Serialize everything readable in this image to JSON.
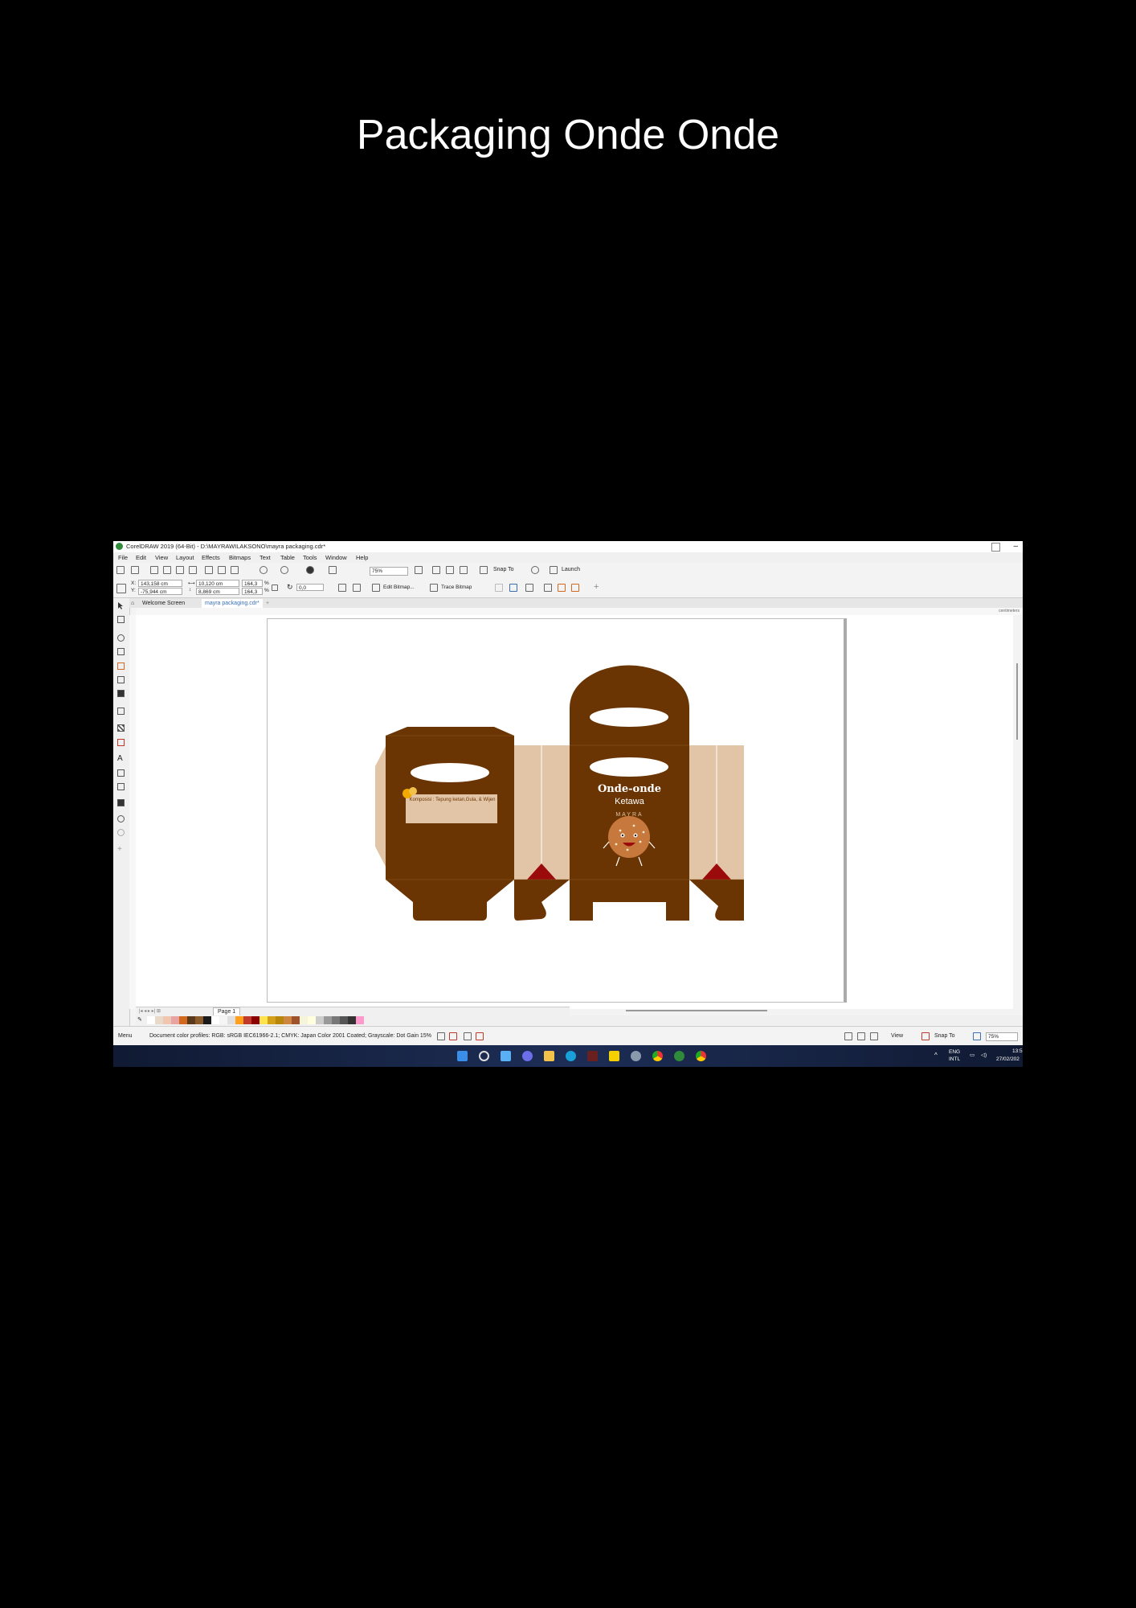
{
  "slide": {
    "title": "Packaging Onde Onde"
  },
  "window": {
    "title": "CorelDRAW 2019 (64-Bit) - D:\\MAYRAWILAKSONO\\mayra packaging.cdr*"
  },
  "menu": [
    "File",
    "Edit",
    "View",
    "Layout",
    "Effects",
    "Bitmaps",
    "Text",
    "Table",
    "Tools",
    "Window",
    "Help"
  ],
  "standard_toolbar": {
    "zoom": "75%",
    "snap_label": "Snap To",
    "launch_label": "Launch"
  },
  "property_bar": {
    "x_label": "X:",
    "x_value": "143,158 cm",
    "y_label": "Y:",
    "y_value": "-75,944 cm",
    "w_value": "10,120 cm",
    "h_value": "8,869 cm",
    "scale_w": "164,3",
    "scale_h": "164,3",
    "percent": "%",
    "angle": "0,0",
    "edit_bitmap": "Edit Bitmap...",
    "trace_bitmap": "Trace Bitmap"
  },
  "tabs": [
    {
      "label": "Welcome Screen"
    },
    {
      "label": "mayra packaging.cdr*"
    }
  ],
  "ruler_unit": "centimeters",
  "artwork": {
    "product_name": "Onde-onde",
    "product_sub": "Ketawa",
    "brand": "MAYRA",
    "composition": "Komposisi : Tepung ketan,Gula, & Wijen"
  },
  "page_nav": {
    "page_label": "Page 1"
  },
  "palette": [
    "#ffffff",
    "#e8d9c8",
    "#f0c6b0",
    "#e8a3a3",
    "#d2691e",
    "#5a3a1a",
    "#8b5a2b",
    "#1a1a1a",
    "#ffffff",
    "#f5f5f5",
    "#e0e0e0",
    "#ff9f1a",
    "#c0392b",
    "#8b0000",
    "#ffe34d",
    "#d4a017",
    "#b8860b",
    "#cd853f",
    "#a0522d",
    "#f5f5dc",
    "#ffffe0",
    "#cccccc",
    "#999999",
    "#777777",
    "#555555",
    "#333333",
    "#ff99cc"
  ],
  "status": {
    "menu_label": "Menu",
    "color_profiles": "Document color profiles: RGB: sRGB IEC61966-2.1; CMYK: Japan Color 2001 Coated; Grayscale: Dot Gain 15%",
    "view_label": "View",
    "snap_label": "Snap To",
    "zoom": "75%"
  },
  "tray": {
    "lang1": "ENG",
    "lang2": "INTL",
    "time": "13:5",
    "date": "27/02/202"
  },
  "colors": {
    "box_brown": "#6b3503",
    "box_tan": "#e2c5a7",
    "accent_red": "#9b0b0b",
    "cookie": "#c7793d"
  }
}
